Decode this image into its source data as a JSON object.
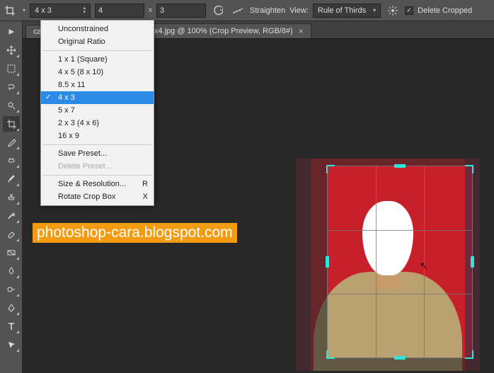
{
  "optionsBar": {
    "ratio_selected": "4 x 3",
    "width_value": "4",
    "height_value": "3",
    "straighten_label": "Straighten",
    "view_label": "View:",
    "view_selected": "Rule of Thirds",
    "delete_cropped_label": "Delete Cropped",
    "delete_cropped_checked": true
  },
  "ratioMenu": {
    "items": [
      {
        "label": "Unconstrained"
      },
      {
        "label": "Original Ratio"
      }
    ],
    "presets": [
      {
        "label": "1 x 1 (Square)"
      },
      {
        "label": "4 x 5 (8 x 10)"
      },
      {
        "label": "8.5 x 11"
      },
      {
        "label": "4 x 3",
        "selected": true
      },
      {
        "label": "5 x 7"
      },
      {
        "label": "2 x 3 (4 x 6)"
      },
      {
        "label": "16 x 9"
      }
    ],
    "actions1": [
      {
        "label": "Save Preset..."
      },
      {
        "label": "Delete Preset...",
        "disabled": true
      }
    ],
    "actions2": [
      {
        "label": "Size & Resolution...",
        "shortcut": "R"
      },
      {
        "label": "Rotate Crop Box",
        "shortcut": "X"
      }
    ]
  },
  "tab": {
    "prefix": "cara",
    "title_visible": "foto 3x4.jpg @ 100% (Crop Preview, RGB/8#)"
  },
  "watermark": "photoshop-cara.blogspot.com",
  "tools": [
    "move-tool",
    "marquee-tool",
    "lasso-tool",
    "quick-select-tool",
    "crop-tool",
    "eyedropper-tool",
    "healing-brush-tool",
    "brush-tool",
    "clone-stamp-tool",
    "history-brush-tool",
    "eraser-tool",
    "gradient-tool",
    "blur-tool",
    "dodge-tool",
    "pen-tool",
    "type-tool",
    "path-select-tool"
  ]
}
